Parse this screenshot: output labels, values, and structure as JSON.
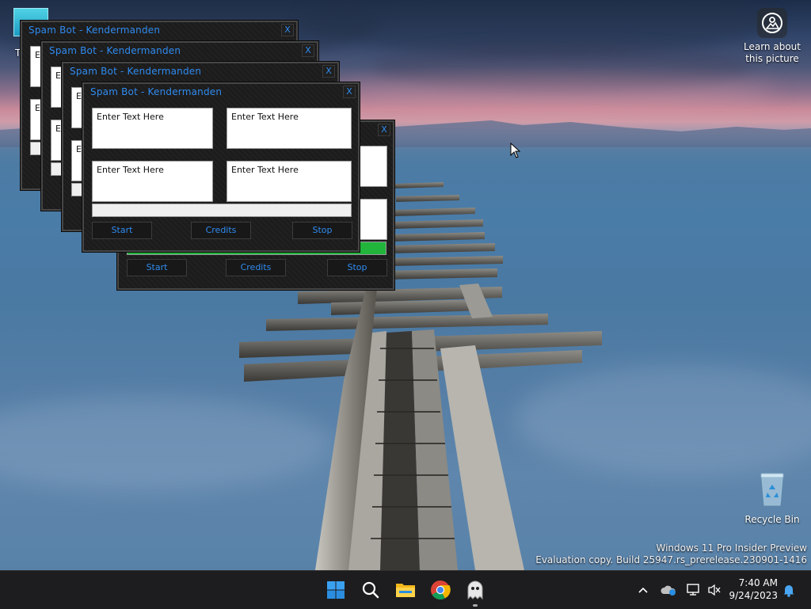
{
  "desktop": {
    "learn_icon": {
      "label_line1": "Learn about",
      "label_line2": "this picture",
      "icon": "camera-info-icon"
    },
    "recycle_bin": {
      "label": "Recycle Bin",
      "icon": "recycle-bin-icon"
    },
    "partial_icon_label": "T",
    "watermark": {
      "line1": "Windows 11 Pro Insider Preview",
      "line2": "Evaluation copy. Build 25947.rs_prerelease.230901-1416"
    }
  },
  "windows": [
    {
      "title": "Spam Bot - Kendermanden",
      "close": "X",
      "field_tl": "E",
      "field_bl": "E"
    },
    {
      "title": "Spam Bot - Kendermanden",
      "close": "X",
      "field_tl": "E",
      "field_bl": "E"
    },
    {
      "title": "Spam Bot - Kendermanden",
      "close": "X",
      "field_tl": "E",
      "field_bl": "E"
    },
    {
      "title": "Spam Bot - Kendermanden",
      "close": "X",
      "field_1": "Enter Text Here",
      "field_2": "Enter Text Here",
      "field_3": "Enter Text Here",
      "field_4": "Enter Text Here",
      "progress": 0,
      "start": "Start",
      "credits": "Credits",
      "stop": "Stop"
    },
    {
      "close": "X",
      "progress": 1.0,
      "start": "Start",
      "credits": "Credits",
      "stop": "Stop"
    }
  ],
  "taskbar": {
    "apps": [
      "windows-start-icon",
      "search-icon",
      "file-explorer-icon",
      "chrome-icon",
      "spam-bot-app-icon"
    ],
    "clock": {
      "time": "7:40 AM",
      "date": "9/24/2023"
    },
    "tray": [
      "chevron-up-icon",
      "onedrive-icon",
      "network-icon",
      "volume-muted-icon",
      "notification-bell-icon"
    ]
  },
  "colors": {
    "title_blue": "#2f8bf0",
    "progress_green": "#22b53c",
    "window_bg": "#1c1c1c"
  }
}
